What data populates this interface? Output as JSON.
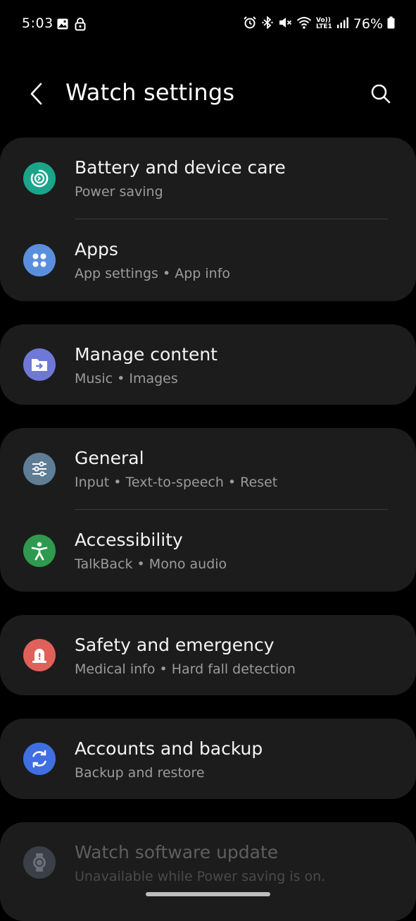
{
  "status_bar": {
    "time": "5:03",
    "battery": "76%",
    "icons_left": [
      "image-icon",
      "lock-icon"
    ],
    "icons_right": [
      "alarm-icon",
      "bluetooth-icon",
      "mute-icon",
      "wifi-icon",
      "volte-icon",
      "signal-icon",
      "battery-icon"
    ],
    "volte_label_top": "Vo))",
    "volte_label_bottom": "LTE1"
  },
  "header": {
    "title": "Watch settings"
  },
  "groups": [
    {
      "items": [
        {
          "title": "Battery and device care",
          "subtitle": "Power saving",
          "icon": "battery-care-icon",
          "color": "#1aa58a"
        },
        {
          "title": "Apps",
          "subtitle": "App settings • App info",
          "icon": "apps-icon",
          "color": "#5a8fdd"
        }
      ]
    },
    {
      "items": [
        {
          "title": "Manage content",
          "subtitle": "Music • Images",
          "icon": "manage-content-icon",
          "color": "#6f78d6"
        }
      ]
    },
    {
      "items": [
        {
          "title": "General",
          "subtitle": "Input • Text-to-speech • Reset",
          "icon": "general-icon",
          "color": "#5f7d95"
        },
        {
          "title": "Accessibility",
          "subtitle": "TalkBack • Mono audio",
          "icon": "accessibility-icon",
          "color": "#2f9a4f"
        }
      ]
    },
    {
      "items": [
        {
          "title": "Safety and emergency",
          "subtitle": "Medical info • Hard fall detection",
          "icon": "safety-icon",
          "color": "#e0605a"
        }
      ]
    },
    {
      "items": [
        {
          "title": "Accounts and backup",
          "subtitle": "Backup and restore",
          "icon": "accounts-backup-icon",
          "color": "#3f6fe0"
        }
      ]
    },
    {
      "items": [
        {
          "title": "Watch software update",
          "subtitle": "Unavailable while Power saving is on.",
          "icon": "software-update-icon",
          "color": "#3b3f48",
          "disabled": true
        }
      ]
    }
  ]
}
